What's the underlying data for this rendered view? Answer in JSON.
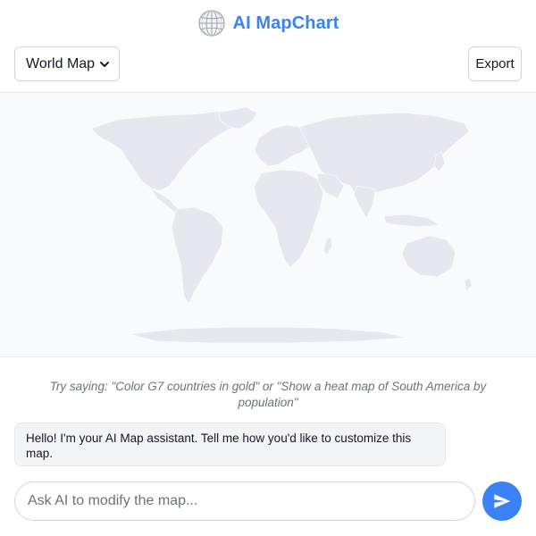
{
  "app": {
    "title": "AI MapChart",
    "logo_icon": "globe-icon",
    "accent_color": "#3b82f6"
  },
  "toolbar": {
    "map_select": {
      "selected": "World Map",
      "icon": "chevron-down-icon"
    },
    "export_label": "Export"
  },
  "map": {
    "land_color": "#e5e9ef",
    "background_color": "#f9fafb"
  },
  "chat": {
    "hint": "Try saying: \"Color G7 countries in gold\" or \"Show a heat map of South America by population\"",
    "messages": [
      {
        "role": "assistant",
        "text": "Hello! I'm your AI Map assistant. Tell me how you'd like to customize this map."
      }
    ],
    "input_placeholder": "Ask AI to modify the map...",
    "send_icon": "send-icon"
  }
}
